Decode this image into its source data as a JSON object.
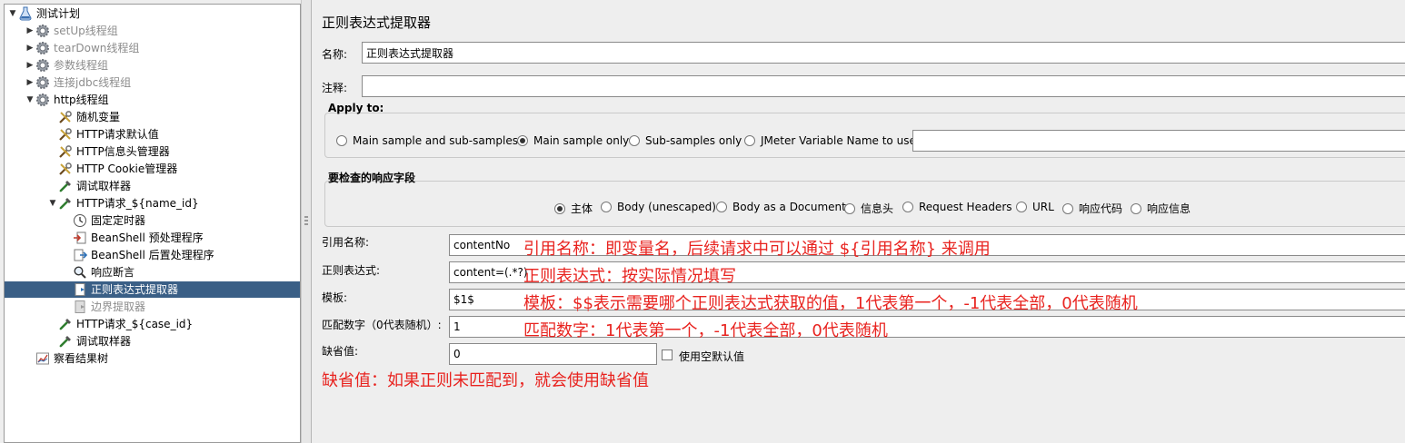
{
  "tree": {
    "items": [
      {
        "label": "测试计划",
        "level": 0,
        "toggle": "▼",
        "icon": "flask-icon",
        "disabled": false,
        "selected": false
      },
      {
        "label": "setUp线程组",
        "level": 1,
        "toggle": "▶",
        "icon": "gear-icon",
        "disabled": true,
        "selected": false
      },
      {
        "label": "tearDown线程组",
        "level": 1,
        "toggle": "▶",
        "icon": "gear-icon",
        "disabled": true,
        "selected": false
      },
      {
        "label": "参数线程组",
        "level": 1,
        "toggle": "▶",
        "icon": "gear-icon",
        "disabled": true,
        "selected": false
      },
      {
        "label": "连接jdbc线程组",
        "level": 1,
        "toggle": "▶",
        "icon": "gear-icon",
        "disabled": true,
        "selected": false
      },
      {
        "label": "http线程组",
        "level": 1,
        "toggle": "▼",
        "icon": "gear-icon",
        "disabled": false,
        "selected": false
      },
      {
        "label": "随机变量",
        "level": 2,
        "toggle": "",
        "icon": "wrench-icon",
        "disabled": false,
        "selected": false
      },
      {
        "label": "HTTP请求默认值",
        "level": 2,
        "toggle": "",
        "icon": "wrench-icon",
        "disabled": false,
        "selected": false
      },
      {
        "label": "HTTP信息头管理器",
        "level": 2,
        "toggle": "",
        "icon": "wrench-icon",
        "disabled": false,
        "selected": false
      },
      {
        "label": "HTTP Cookie管理器",
        "level": 2,
        "toggle": "",
        "icon": "wrench-icon",
        "disabled": false,
        "selected": false
      },
      {
        "label": "调试取样器",
        "level": 2,
        "toggle": "",
        "icon": "pipette-icon",
        "disabled": false,
        "selected": false
      },
      {
        "label": "HTTP请求_${name_id}",
        "level": 2,
        "toggle": "▼",
        "icon": "pipette-icon",
        "disabled": false,
        "selected": false
      },
      {
        "label": "固定定时器",
        "level": 3,
        "toggle": "",
        "icon": "clock-icon",
        "disabled": false,
        "selected": false
      },
      {
        "label": "BeanShell 预处理程序",
        "level": 3,
        "toggle": "",
        "icon": "preprocessor-icon",
        "disabled": false,
        "selected": false
      },
      {
        "label": "BeanShell 后置处理程序",
        "level": 3,
        "toggle": "",
        "icon": "postprocessor-icon",
        "disabled": false,
        "selected": false
      },
      {
        "label": "响应断言",
        "level": 3,
        "toggle": "",
        "icon": "magnifier-icon",
        "disabled": false,
        "selected": false
      },
      {
        "label": "正则表达式提取器",
        "level": 3,
        "toggle": "",
        "icon": "extractor-icon",
        "disabled": false,
        "selected": true
      },
      {
        "label": "边界提取器",
        "level": 3,
        "toggle": "",
        "icon": "extractor-gray-icon",
        "disabled": true,
        "selected": false
      },
      {
        "label": "HTTP请求_${case_id}",
        "level": 2,
        "toggle": "",
        "icon": "pipette-icon",
        "disabled": false,
        "selected": false
      },
      {
        "label": "调试取样器",
        "level": 2,
        "toggle": "",
        "icon": "pipette-icon",
        "disabled": false,
        "selected": false
      },
      {
        "label": "察看结果树",
        "level": 1,
        "toggle": "",
        "icon": "chart-icon",
        "disabled": false,
        "selected": false
      }
    ]
  },
  "panel": {
    "title": "正则表达式提取器",
    "name_label": "名称:",
    "name_value": "正则表达式提取器",
    "comment_label": "注释:",
    "comment_value": "",
    "apply_to": {
      "title": "Apply to:",
      "options": [
        {
          "label": "Main sample and sub-samples",
          "checked": false
        },
        {
          "label": "Main sample only",
          "checked": true
        },
        {
          "label": "Sub-samples only",
          "checked": false
        },
        {
          "label": "JMeter Variable Name to use",
          "checked": false
        }
      ],
      "variable_value": ""
    },
    "field_to_check": {
      "title": "要检查的响应字段",
      "options": [
        {
          "label": "主体",
          "checked": true
        },
        {
          "label": "Body (unescaped)",
          "checked": false
        },
        {
          "label": "Body as a Document",
          "checked": false
        },
        {
          "label": "信息头",
          "checked": false
        },
        {
          "label": "Request Headers",
          "checked": false
        },
        {
          "label": "URL",
          "checked": false
        },
        {
          "label": "响应代码",
          "checked": false
        },
        {
          "label": "响应信息",
          "checked": false
        }
      ]
    },
    "ref_name_label": "引用名称:",
    "ref_name_value": "contentNo",
    "regex_label": "正则表达式:",
    "regex_value": "content=(.*?)",
    "template_label": "模板:",
    "template_value": "$1$",
    "match_no_label": "匹配数字（0代表随机）:",
    "match_no_value": "1",
    "default_label": "缺省值:",
    "default_value": "0",
    "use_empty_label": "使用空默认值",
    "use_empty_checked": false
  },
  "annotations": {
    "ref_name": "引用名称：即变量名，后续请求中可以通过 ${引用名称} 来调用",
    "regex": "正则表达式：按实际情况填写",
    "template": "模板：$$表示需要哪个正则表达式获取的值，1代表第一个，-1代表全部，0代表随机",
    "match_no": "匹配数字：1代表第一个，-1代表全部，0代表随机",
    "default": "缺省值：如果正则未匹配到，就会使用缺省值"
  },
  "colors": {
    "annotation": "#e8231f",
    "selection": "#3a5f86"
  }
}
